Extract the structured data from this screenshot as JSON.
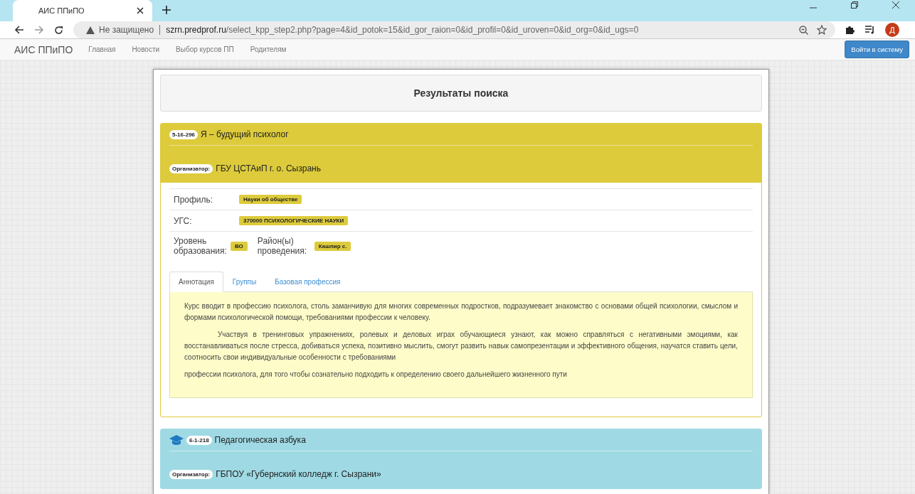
{
  "browser": {
    "tabs": [
      {
        "title": "АИС ППиПО",
        "selected": true
      }
    ],
    "address": {
      "security": "Не защищено",
      "host": "szrn.predprof.ru",
      "path": "/select_kpp_step2.php?page=4&id_potok=15&id_gor_raion=0&id_profil=0&id_uroven=0&id_org=0&id_ugs=0"
    },
    "profile_initial": "Д"
  },
  "navbar": {
    "brand": "АИС ППиПО",
    "links": [
      "Главная",
      "Новости",
      "Выбор курсов ПП",
      "Родителям"
    ],
    "login": "Войти в систему"
  },
  "heading": "Результаты поиска",
  "courses": [
    {
      "code": "5-16-296",
      "title": "Я – будущий психолог",
      "organizer_label": "Организатор:",
      "organizer": "ГБУ ЦСТАиП г. о. Сызрань",
      "color": "#ddcb3c",
      "cap_icon": false,
      "details": {
        "rows": [
          {
            "label": "Профиль:",
            "value": "Науки об обществе"
          },
          {
            "label": "УГС:",
            "value": "370000 ПСИХОЛОГИЧЕСКИЕ НАУКИ"
          }
        ],
        "level_label": "Уровень образования:",
        "level": "ВО",
        "district_label": "Район(ы) проведения:",
        "district": "Кашпир с.",
        "tabs": [
          {
            "label": "Аннотация",
            "selected": true
          },
          {
            "label": "Группы",
            "selected": false
          },
          {
            "label": "Базовая профессия",
            "selected": false
          }
        ],
        "paragraphs": [
          {
            "kind": "plain",
            "text": "Курс вводит в профессию психолога, столь заманчивую для многих современных подростков, подразумевает знакомство с основами общей психологии, смыслом и формами психологической помощи, требованиями профессии к человеку."
          },
          {
            "kind": "indented",
            "text": "Участвуя в тренинговых упражнениях, ролевых и деловых играх обучающиеся узнают, как можно справляться с негативными эмоциями, как восстанавливаться после стресса, добиваться успеха, позитивно мыслить, смогут развить навык самопрезентации и эффективного общения, научатся ставить цели, соотносить свои индивидуальные особенности с требованиями"
          },
          {
            "kind": "plain",
            "text": "профессии психолога, для того чтобы сознательно подходить к определению своего дальнейшего жизненного пути"
          }
        ]
      }
    },
    {
      "code": "6-1-218",
      "title": "Педагогическая азбука",
      "organizer_label": "Организатор:",
      "organizer": "ГБПОУ «Губернский колледж г. Сызрани»",
      "color": "#9fdae4",
      "cap_icon": true
    }
  ]
}
